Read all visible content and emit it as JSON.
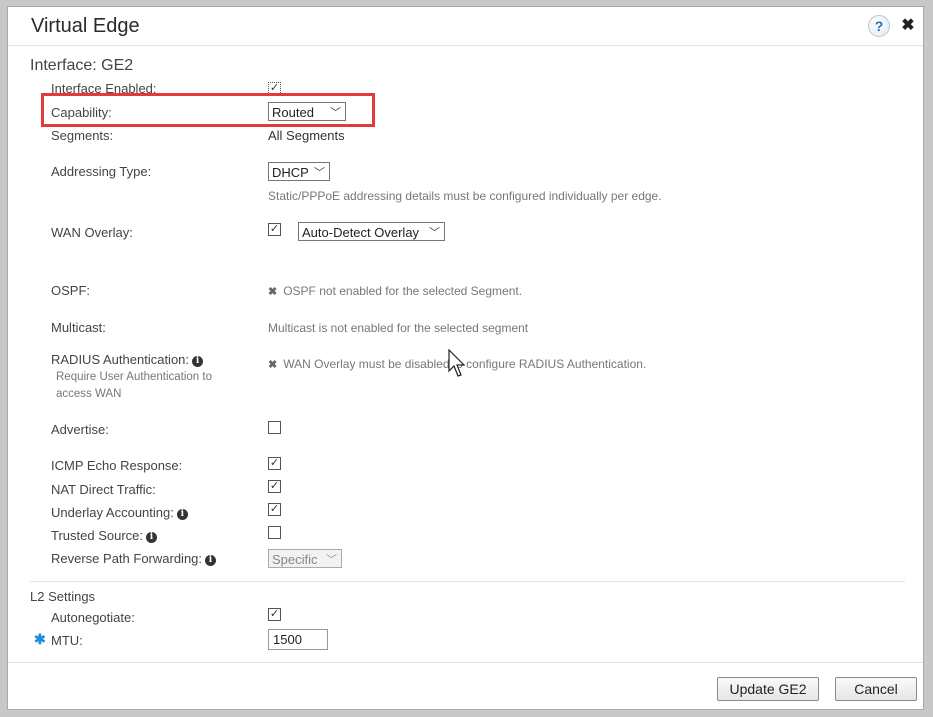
{
  "dialog": {
    "title": "Virtual Edge",
    "help_glyph": "?",
    "close_glyph": "✖"
  },
  "interface": {
    "heading": "Interface: GE2",
    "interface_enabled": {
      "label": "Interface Enabled:",
      "checked": true
    },
    "capability": {
      "label": "Capability:",
      "value": "Routed"
    },
    "segments": {
      "label": "Segments:",
      "value": "All Segments"
    },
    "addressing_type": {
      "label": "Addressing Type:",
      "value": "DHCP",
      "note": "Static/PPPoE addressing details must be configured individually per edge."
    },
    "wan_overlay": {
      "label": "WAN Overlay:",
      "checked": true,
      "value": "Auto-Detect Overlay"
    },
    "ospf": {
      "label": "OSPF:",
      "message": "OSPF not enabled for the selected Segment."
    },
    "multicast": {
      "label": "Multicast:",
      "message": "Multicast is not enabled for the selected segment"
    },
    "radius": {
      "label": "RADIUS Authentication:",
      "sub_line1": "Require User Authentication to",
      "sub_line2": "access WAN",
      "message": "WAN Overlay must be disabled to configure RADIUS Authentication."
    },
    "advertise": {
      "label": "Advertise:",
      "checked": false
    },
    "icmp_echo": {
      "label": "ICMP Echo Response:",
      "checked": true
    },
    "nat_direct": {
      "label": "NAT Direct Traffic:",
      "checked": true
    },
    "underlay_accounting": {
      "label": "Underlay Accounting:",
      "checked": true
    },
    "trusted_source": {
      "label": "Trusted Source:",
      "checked": false
    },
    "rpf": {
      "label": "Reverse Path Forwarding:",
      "value": "Specific"
    }
  },
  "l2": {
    "heading": "L2 Settings",
    "autonegotiate": {
      "label": "Autonegotiate:",
      "checked": true
    },
    "mtu": {
      "label": "MTU:",
      "value": "1500",
      "required_mark": "✱"
    }
  },
  "buttons": {
    "update": "Update GE2",
    "cancel": "Cancel"
  },
  "glyphs": {
    "check": "✓",
    "x_mark": "✖",
    "caret": "﹀",
    "info": "i"
  },
  "colors": {
    "highlight": "#e23b3b",
    "required": "#1f8fd6"
  }
}
